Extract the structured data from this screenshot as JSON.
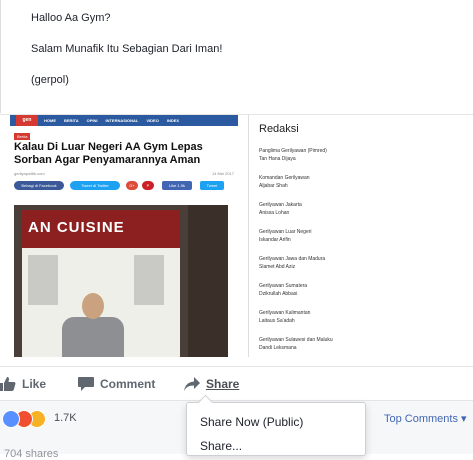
{
  "post": {
    "lines": [
      "Halloo Aa Gym?",
      "Salam Munafik Itu Sebagian Dari Iman!",
      "(gerpol)"
    ]
  },
  "screenshot": {
    "site_logo": "gen",
    "nav": [
      "HOME",
      "BERITA",
      "OPINI",
      "INTERNASIONAL",
      "VIDEO",
      "INDEX"
    ],
    "category": "Berita",
    "headline": "Kalau Di Luar Negeri AA Gym Lepas Sorban Agar Penyamarannya Aman",
    "byline": "gerilyapolitik.com",
    "date": "14 Mei 2017",
    "share_buttons": [
      "Bebagi di Facebook",
      "Tweet di Twitter",
      "G+",
      "P",
      "Like 1.9k",
      "Tweet"
    ],
    "photo_sign": "AN CUISINE",
    "redaksi": {
      "title": "Redaksi",
      "entries": [
        [
          "Panglima Gerilyawan (Pimred)",
          "Tan Hana Dijaya"
        ],
        [
          "Komandan Gerilyawan",
          "Aljabar Shah"
        ],
        [
          "Gerilyawan Jakarta",
          "Anissa Lohan"
        ],
        [
          "Gerilyawan Luar Negeri",
          "Iskandar Arifin"
        ],
        [
          "Gerilyawan Jawa dan Madura",
          "Slamet Abd Aziz"
        ],
        [
          "Gerilyawan Sumatera",
          "Dzikrullah Abbasi"
        ],
        [
          "Gerilyawan Kalimantan",
          "Laitaus Sa'adah"
        ],
        [
          "Gerilyawan Sulawesi dan Maluku",
          "Dandi Leksmana"
        ]
      ]
    }
  },
  "actions": {
    "like": "Like",
    "comment": "Comment",
    "share": "Share"
  },
  "reactions": {
    "count": "1.7K",
    "types": [
      "like-icon",
      "angry-icon",
      "sad-icon"
    ],
    "top_comments": "Top Comments ▾"
  },
  "shares_count": "704 shares",
  "share_menu": {
    "items": [
      "Share Now (Public)",
      "Share..."
    ]
  },
  "colors": {
    "facebook_blue": "#4267b2",
    "site_nav": "#2c5aa0",
    "site_red": "#d43a31"
  }
}
